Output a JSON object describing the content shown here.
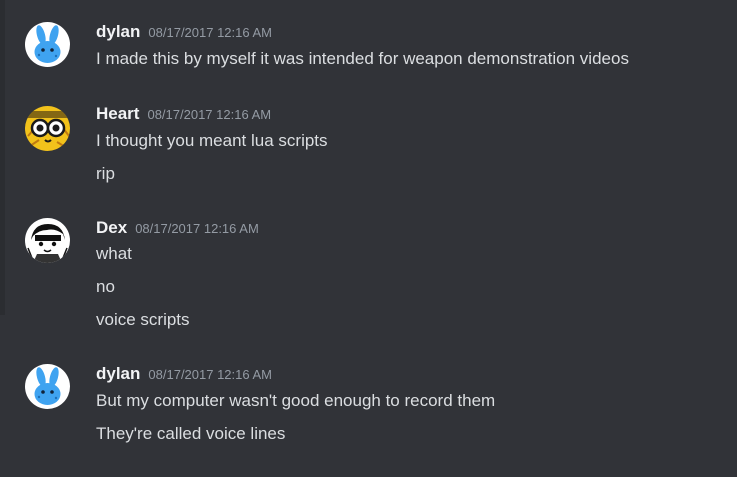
{
  "messages": [
    {
      "author": "dylan",
      "timestamp": "08/17/2017 12:16 AM",
      "avatar_icon": "blue-bunny-avatar",
      "lines": [
        "I made this by myself it was intended for weapon demonstration videos"
      ]
    },
    {
      "author": "Heart",
      "timestamp": "08/17/2017 12:16 AM",
      "avatar_icon": "yellow-goggles-avatar",
      "lines": [
        "I thought you meant lua scripts",
        "rip"
      ]
    },
    {
      "author": "Dex",
      "timestamp": "08/17/2017 12:16 AM",
      "avatar_icon": "monochrome-character-avatar",
      "lines": [
        "what",
        "no",
        "voice scripts"
      ]
    },
    {
      "author": "dylan",
      "timestamp": "08/17/2017 12:16 AM",
      "avatar_icon": "blue-bunny-avatar",
      "lines": [
        "But my computer wasn't good enough to record them",
        "They're called voice lines"
      ]
    }
  ],
  "colors": {
    "background": "#313338",
    "username": "#f2f3f5",
    "timestamp": "#949ba4",
    "message_text": "#dbdee1"
  }
}
